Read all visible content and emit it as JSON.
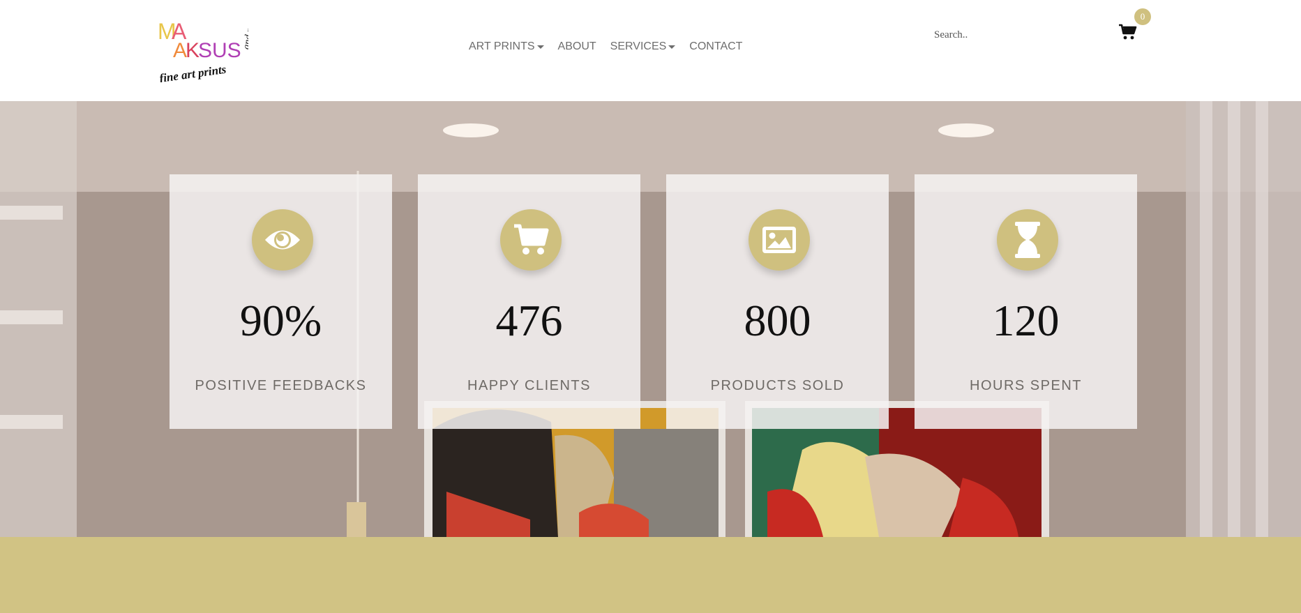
{
  "header": {
    "logo_name": "MAKSUS",
    "nav": [
      {
        "label": "ART PRINTS",
        "dropdown": true
      },
      {
        "label": "ABOUT",
        "dropdown": false
      },
      {
        "label": "SERVICES",
        "dropdown": true
      },
      {
        "label": "CONTACT",
        "dropdown": false
      }
    ],
    "search_placeholder": "Search..",
    "cart_count": "0"
  },
  "stats": [
    {
      "icon": "eye-icon",
      "value": "90%",
      "label": "POSITIVE FEEDBACKS"
    },
    {
      "icon": "cart-icon",
      "value": "476",
      "label": "HAPPY CLIENTS"
    },
    {
      "icon": "image-icon",
      "value": "800",
      "label": "PRODUCTS SOLD"
    },
    {
      "icon": "hourglass-icon",
      "value": "120",
      "label": "HOURS SPENT"
    }
  ],
  "colors": {
    "accent": "#cfc07f",
    "band": "#d1c384",
    "nav_text": "#6d6d6d"
  }
}
